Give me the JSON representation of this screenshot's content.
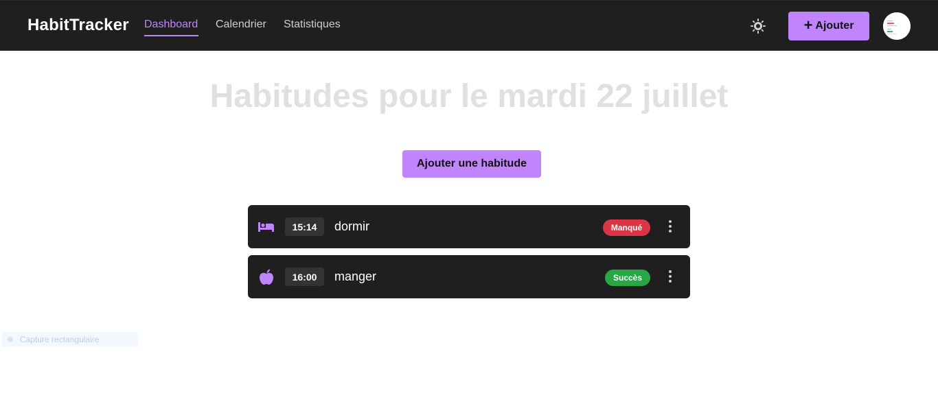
{
  "navbar": {
    "brand": "HabitTracker",
    "links": [
      {
        "label": "Dashboard",
        "active": true
      },
      {
        "label": "Calendrier",
        "active": false
      },
      {
        "label": "Statistiques",
        "active": false
      }
    ],
    "theme_icon": "sun-icon",
    "add_button": {
      "icon": "plus-icon",
      "label": "Ajouter"
    },
    "avatar_icon": "avatar"
  },
  "main": {
    "title": "Habitudes pour le mardi 22 juillet",
    "add_habit_label": "Ajouter une habitude",
    "habits": [
      {
        "icon": "bed-icon",
        "time": "15:14",
        "name": "dormir",
        "status": "Manqué",
        "status_color": "#dc3545"
      },
      {
        "icon": "apple-icon",
        "time": "16:00",
        "name": "manger",
        "status": "Succès",
        "status_color": "#28a745"
      }
    ]
  },
  "overlay": {
    "capture_label": "Capture rectangulaire"
  },
  "colors": {
    "accent": "#c084fc",
    "nav_bg": "#1f1f1f",
    "card_bg": "#1f1f1f",
    "title_color": "#e0e0e0"
  }
}
